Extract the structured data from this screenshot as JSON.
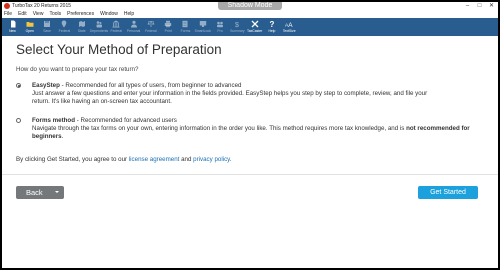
{
  "titlebar": {
    "title": "TurboTax 20 Returns 2015",
    "shadow_mode": "Shadow Mode",
    "controls": [
      "–",
      "□",
      "✕"
    ]
  },
  "menu": [
    "File",
    "Edit",
    "View",
    "Tools",
    "Preferences",
    "Window",
    "Help"
  ],
  "toolbar": {
    "items": [
      {
        "label": "New",
        "icon": "new-file-icon",
        "dim": false
      },
      {
        "label": "Open",
        "icon": "folder-open-icon",
        "dim": false
      },
      {
        "label": "Save",
        "icon": "save-icon",
        "dim": true
      },
      {
        "label": "Federal",
        "icon": "map-pin-icon",
        "dim": true
      },
      {
        "label": "State",
        "icon": "map-icon",
        "dim": true
      },
      {
        "label": "Dependents",
        "icon": "dependents-icon",
        "dim": true
      },
      {
        "label": "Federal",
        "icon": "building-icon",
        "dim": true
      },
      {
        "label": "Personal",
        "icon": "person-icon",
        "dim": true
      },
      {
        "label": "Federal",
        "icon": "scale-icon",
        "dim": true
      },
      {
        "label": "Print",
        "icon": "print-icon",
        "dim": true
      },
      {
        "label": "Forms",
        "icon": "forms-icon",
        "dim": true
      },
      {
        "label": "SmartLook",
        "icon": "smartlook-icon",
        "dim": true
      },
      {
        "label": "Pro",
        "icon": "pro-icon",
        "dim": true
      },
      {
        "label": "Summary",
        "icon": "summary-icon",
        "dim": true
      },
      {
        "label": "TaxCaster",
        "icon": "taxcaster-icon",
        "dim": false
      },
      {
        "label": "Help",
        "icon": "help-icon",
        "dim": false
      },
      {
        "label": "TextSize",
        "icon": "text-size-icon",
        "dim": false
      }
    ]
  },
  "page": {
    "title": "Select Your Method of Preparation",
    "question": "How do you want to prepare your tax return?",
    "options": [
      {
        "name": "EasyStep",
        "summary": " - Recommended for all types of users, from beginner to advanced",
        "desc_line1": "Just answer a few questions and enter your information in the fields provided. EasyStep helps you step by step to complete, review, and file your",
        "desc_line2": "return. It's like having an on-screen tax accountant.",
        "selected": true
      },
      {
        "name": "Forms method",
        "summary": " - Recommended for advanced users",
        "desc_line1": "Navigate through the tax forms on your own, entering information in the order you like. This method requires more tax knowledge, and is ",
        "desc_bold": "not recommended for beginners",
        "desc_end": ".",
        "selected": false
      }
    ],
    "agreement": {
      "prefix": "By clicking Get Started, you agree to our ",
      "license_link": "license agreement",
      "and": " and ",
      "privacy_link": "privacy policy",
      "suffix": "."
    }
  },
  "footer": {
    "back_label": "Back",
    "start_label": "Get Started"
  },
  "colors": {
    "toolbar_bg": "#2a5d8f",
    "link": "#1b6fb3",
    "primary_button": "#1da1dc",
    "back_button": "#75787b",
    "shadow_mode_bg": "#a9a9a9"
  }
}
